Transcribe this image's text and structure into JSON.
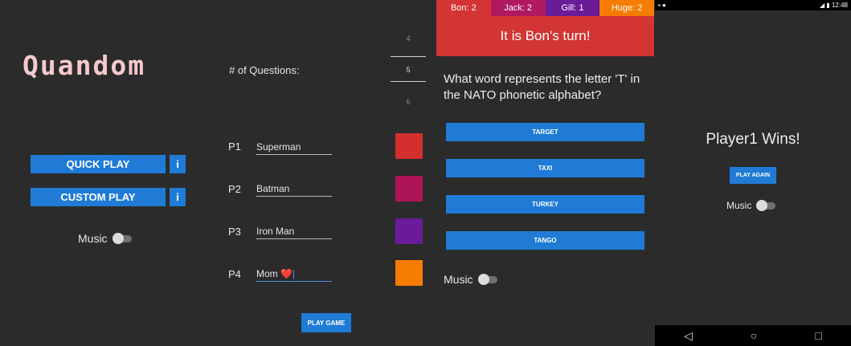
{
  "menu": {
    "logo": "Quandom",
    "quick_play": "QUICK PLAY",
    "custom_play": "CUSTOM PLAY",
    "info_label": "i",
    "music_label": "Music"
  },
  "setup": {
    "questions_label": "# of Questions:",
    "number_picker": [
      "4",
      "5",
      "6"
    ],
    "players": [
      {
        "label": "P1",
        "name": "Superman",
        "color": "#d32f2f"
      },
      {
        "label": "P2",
        "name": "Batman",
        "color": "#ad1457"
      },
      {
        "label": "P3",
        "name": "Iron Man",
        "color": "#6a1b9a"
      },
      {
        "label": "P4",
        "name": "Mom",
        "color": "#f57c00"
      }
    ],
    "p4_emoji": "❤️",
    "play_game": "PLAY GAME"
  },
  "game": {
    "scores": [
      {
        "text": "Bon: 2",
        "color": "#d33434"
      },
      {
        "text": "Jack: 2",
        "color": "#b0195f"
      },
      {
        "text": "Gill: 1",
        "color": "#6a1b9a"
      },
      {
        "text": "Huge: 2",
        "color": "#f57c00"
      }
    ],
    "turn": "It is Bon's turn!",
    "question": "What word represents the letter 'T' in the NATO phonetic alphabet?",
    "answers": [
      "TARGET",
      "TAXI",
      "TURKEY",
      "TANGO"
    ],
    "music_label": "Music"
  },
  "result": {
    "status_time": "12:48",
    "winner": "Player1 Wins!",
    "play_again": "PLAY AGAIN",
    "music_label": "Music",
    "nav": [
      "◁",
      "○",
      "□"
    ]
  }
}
